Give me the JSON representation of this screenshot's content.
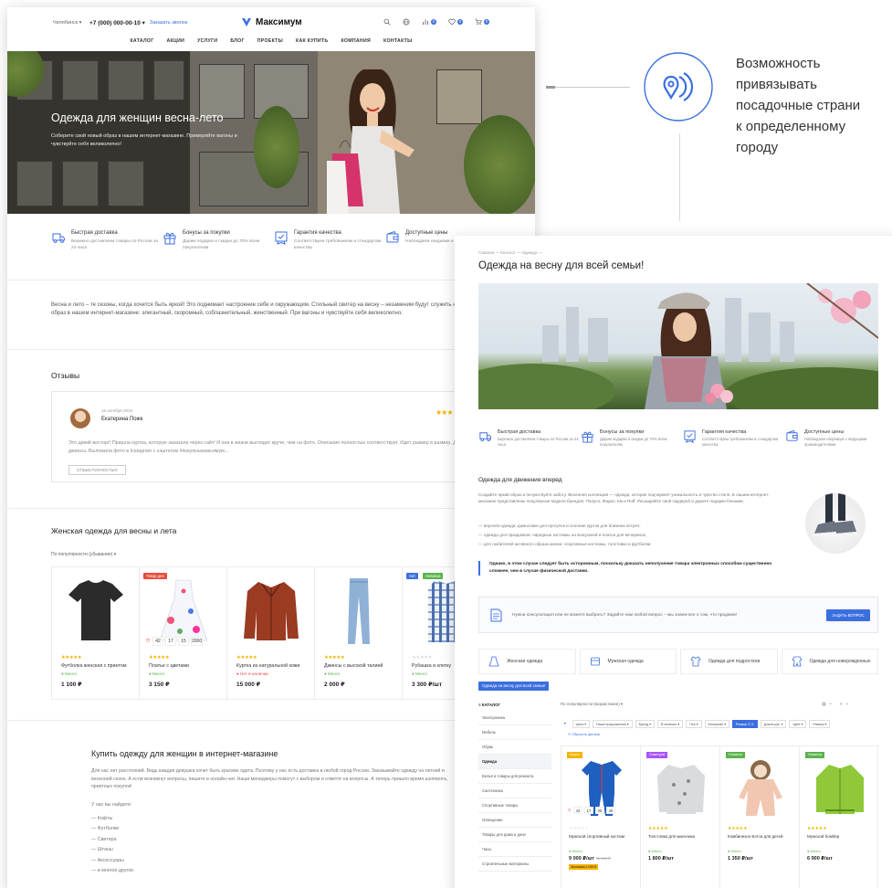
{
  "left_page": {
    "topbar": {
      "city": "Челябинск ▾",
      "phone": "+7 (000) 000-00-10 ▾",
      "callback": "Заказать звонок",
      "logo_text": "Максимум",
      "compare_count": "0",
      "favorites_count": "0",
      "cart_count": "0"
    },
    "nav": [
      "КАТАЛОГ",
      "АКЦИИ",
      "УСЛУГИ",
      "БЛОГ",
      "ПРОЕКТЫ",
      "КАК КУПИТЬ",
      "КОМПАНИЯ",
      "КОНТАКТЫ"
    ],
    "hero": {
      "title": "Одежда для женщин весна-лето",
      "text": "Соберите свой новый образ в нашем интернет-магазине. Примеряйте вагоны и чувствуйте себя великолепно!"
    },
    "features": [
      {
        "title": "Быстрая доставка",
        "text": "Бережно доставляем товары по России за 24 часа",
        "icon": "delivery-icon"
      },
      {
        "title": "Бонусы за покупки",
        "text": "Дарим подарки и скидки до 70% всем покупателям",
        "icon": "gift-icon"
      },
      {
        "title": "Гарантия качества",
        "text": "Соответствуем требованиям и стандартам качества",
        "icon": "quality-icon"
      },
      {
        "title": "Доступные цены",
        "text": "Наблюдаем скидками и производителями",
        "icon": "wallet-icon"
      }
    ],
    "intro": "Весна и лето – те сезоны, когда хочется быть яркой! Это поднимает настроение себе и окружающим. Стильный свитер на весну – незаменим будут служить не один год! Соберите свой образ в нашем интернет-магазине: элегантный, скоромный, соблазнительный, женственный. При вагоны и чувствуйте себя великолепно.",
    "reviews": {
      "title": "Отзывы",
      "date": "16 октября 2019",
      "name": "Екатерина Пожк",
      "stars": "★★★",
      "text": "Это дикий восторг! Пришла куртка, которую заказала через сайт! И она в жизни выглядит круче, чем на фото. Описание полностью соответствует. Идет размер в размер. До этого я заказывала здесь джинсы. Выложила фото в Instagram с хэштегом #покупкаэмаксимум...",
      "button": "ОТЗЫВ ПОЛНОСТЬЮ"
    },
    "catalog": {
      "title": "Женская одежда для весны и лета",
      "sort": "По популярности (убывание) ▾",
      "products": [
        {
          "name": "Футболка женская с принтом",
          "stars": "★★★★★",
          "avail": "● Много",
          "price": "1 100 ₽"
        },
        {
          "name": "Платье с цветами",
          "stars": "★★★★★",
          "avail": "● Много",
          "price": "3 150 ₽",
          "sticker": "Товар дня",
          "countdown": [
            "42",
            "17",
            "15",
            "2000"
          ]
        },
        {
          "name": "Куртка из натуральной кожи",
          "stars": "★★★★★",
          "avail": "● Нет в наличии",
          "price": "15 000 ₽"
        },
        {
          "name": "Джинсы с высокой талией",
          "stars": "★★★★★",
          "avail": "● Много",
          "price": "2 000 ₽"
        },
        {
          "name": "Рубашка в клетку",
          "stars": "★★★★★",
          "avail": "● Много",
          "price": "3 300 ₽/шт",
          "sticker": "Хит",
          "sticker2": "Новинка"
        }
      ]
    },
    "buy": {
      "title": "Купить одежду для женщин в интернет-магазине",
      "text": "Для нас нет расстояний. Ведь каждая девушка хочет быть красиво одета. Поэтому у нас есть доставка в любой город России. Заказывайте одежду на летний и весенний сезон. А если возникнут вопросы, пишите в онлайн-чат. Наши менеджеры помогут с выбором и ответят на вопросы. А теперь пришло время шоппинга, приятных покупок!",
      "lead": "У нас вы найдете:",
      "list": [
        "— Кофты",
        "— Футболки",
        "— Свитера",
        "— Штаны",
        "— Аксессуары",
        "— и многое другое."
      ]
    }
  },
  "callout": {
    "text": "Возможность\nпривязывать\nпосадочные страни\nк определенному\nгороду",
    "icon": "location-pin-icon"
  },
  "right_page": {
    "breadcrumb": "Главная  —  Каталог  —  Одежда  —",
    "title": "Одежда на весну для всей семьи!",
    "features": [
      {
        "title": "Быстрая доставка",
        "text": "Бережно доставляем товары по России за 24 часа",
        "icon": "delivery-icon"
      },
      {
        "title": "Бонусы за покупки",
        "text": "Дарим подарки и скидки до 70% всем покупателям",
        "icon": "gift-icon"
      },
      {
        "title": "Гарантия качества",
        "text": "Соответствуем требованиям и стандартам качества",
        "icon": "quality-icon"
      },
      {
        "title": "Доступные цены",
        "text": "Наблюдаем напрямую с ведущими производителями",
        "icon": "wallet-icon"
      }
    ],
    "section_title": "Одежда для движения вперед",
    "section_text": "Создайте яркий образ и почувствуйте заботу. Весенняя коллекция — одежда, которая подчеркнет уникальность и чувство стиля. В нашем интернет-магазине представлены популярные модели брендов: Полусо, Жарко, Км и Roff. Расширяйте свой гардероб и дарите подарки близким.",
    "section_list": [
      "—  верхняя одежда: джинсовки для прогулок и осенние куртки для ближних встреч;",
      "—  одежда для праздников: нарядные костюмы на выпускной и платья для вечеринок;",
      "—  для любителей активного образа жизни: спортивные костюмы, толстовки и футболки."
    ],
    "quote": "Однако, в этом случае следует быть осторожным, поскольку доказать неполучение товара электронных способом существенно сложнее, чем в случае физической доставки.",
    "consult": {
      "text": "Нужна консультация или не можете выбрать? Задайте нам любой вопрос – мы знаем все о том, что продаем!",
      "button": "ЗАДАТЬ ВОПРОС"
    },
    "categories": [
      {
        "label": "Женская одежда",
        "icon": "dress-icon"
      },
      {
        "label": "Мужская одежда",
        "icon": "shirt-icon"
      },
      {
        "label": "Одежда для подростков",
        "icon": "teen-icon"
      },
      {
        "label": "Одежда для новорожденных",
        "icon": "baby-icon"
      }
    ],
    "tag": "Одежда на весну для всей семьи!",
    "sidebar": {
      "header": "≡  КАТАЛОГ",
      "items": [
        "Электроника",
        "Мебель",
        "Обувь",
        "Одежда",
        "Бельё и товары для ремонта",
        "Сантехника",
        "Спортивные товары",
        "Освещение",
        "Товары для дома и дачи",
        "Часы",
        "Строительные материалы"
      ],
      "active": 3
    },
    "sort": "По популярности (возрастание) ▾",
    "filters": [
      "Цена ▾",
      "Наши предложения ▾",
      "Бренд ▾",
      "В наличии ▾",
      "Пол ▾",
      "Материал ▾",
      "Размер S ✕",
      "Длина рук. ▾",
      "Цвет ▾",
      "Размер ▾"
    ],
    "filters_active": 6,
    "reset": "✕ Сбросить фильтр",
    "products": [
      {
        "name": "Мужской спортивный костюм",
        "stars": "☆☆☆☆☆",
        "avail": "● Много",
        "price": "9 000 ₽/шт",
        "old": "10 000 ₽",
        "save": "Экономия 1 000 ₽",
        "sticker": "Акция",
        "sticker_color": "#f5b300",
        "countdown": [
          "42",
          "17",
          "05",
          "40"
        ]
      },
      {
        "name": "Толстовка для мальчика",
        "stars": "★★★★★",
        "avail": "● Много",
        "price": "1 800 ₽/шт",
        "sticker": "Советуем",
        "sticker_color": "#a855f7"
      },
      {
        "name": "Комбинезон Бэтси для детей",
        "stars": "★★★★★",
        "avail": "● Много",
        "price": "1 350 ₽/шт",
        "sticker": "Новинка",
        "sticker_color": "#5bb44d"
      },
      {
        "name": "Мужской бомбер",
        "stars": "★★★★★",
        "avail": "● Много",
        "price": "6 900 ₽/шт",
        "sticker": "Новинка",
        "sticker_color": "#5bb44d"
      }
    ]
  },
  "colors": {
    "accent": "#3b6fe0",
    "star": "#f5b300",
    "in_stock": "#5bb44d",
    "out_stock": "#e74c3c"
  }
}
